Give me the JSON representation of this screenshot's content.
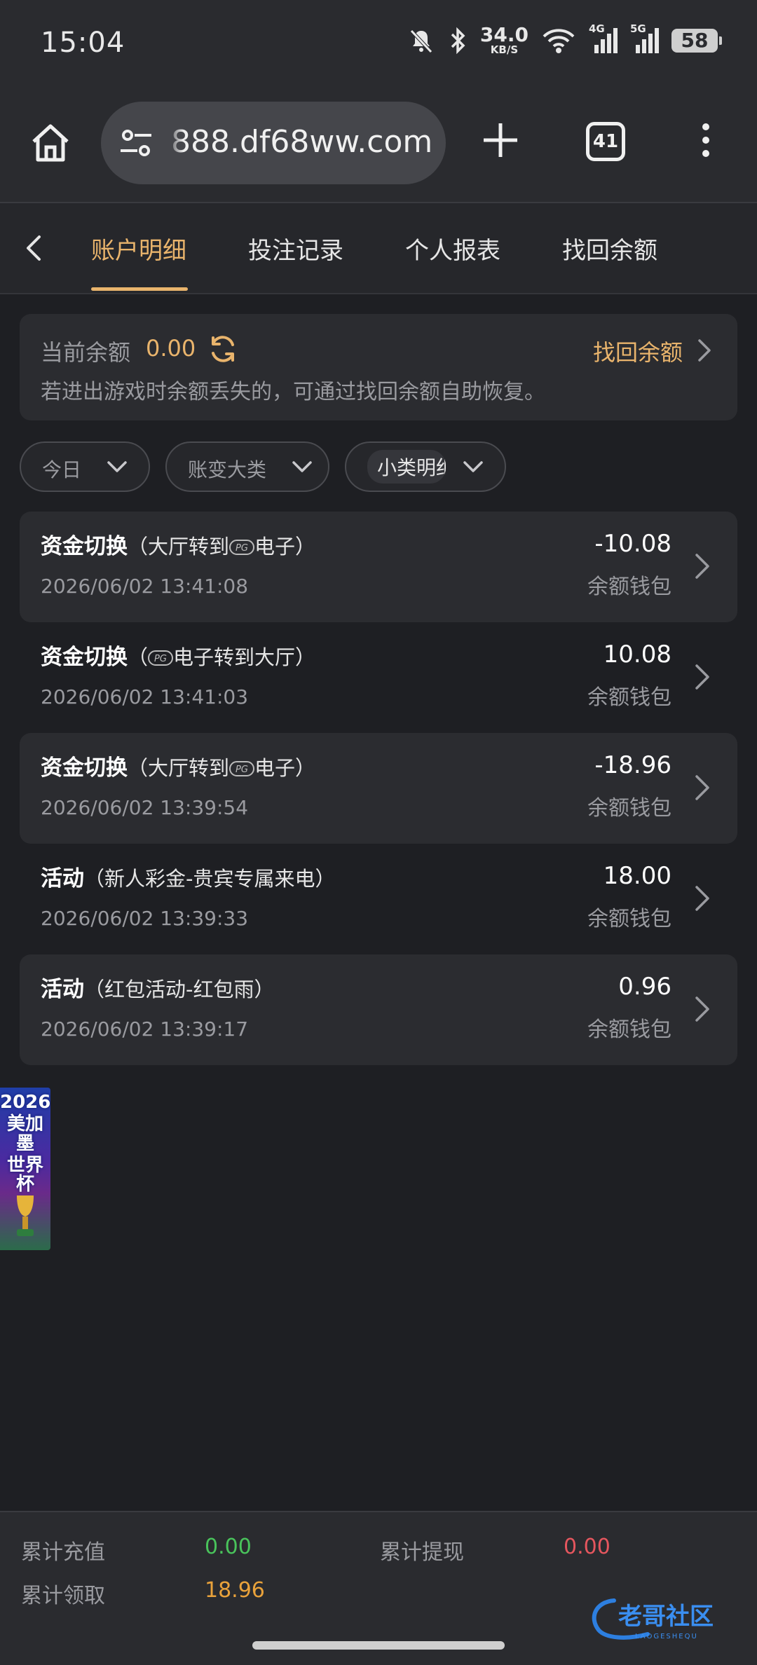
{
  "status_bar": {
    "time": "15:04",
    "net_speed_value": "34.0",
    "net_speed_unit": "KB/S",
    "signal1_label": "4G",
    "signal2_label": "5G",
    "battery": "58"
  },
  "browser": {
    "url": "888.df68ww.com",
    "tab_count": "41"
  },
  "page_tabs": [
    {
      "label": "账户明细",
      "active": true
    },
    {
      "label": "投注记录",
      "active": false
    },
    {
      "label": "个人报表",
      "active": false
    },
    {
      "label": "找回余额",
      "active": false
    }
  ],
  "balance": {
    "label": "当前余额",
    "value": "0.00",
    "recover_link": "找回余额",
    "note": "若进出游戏时余额丢失的，可通过找回余额自助恢复。"
  },
  "filters": [
    {
      "label": "今日"
    },
    {
      "label": "账变大类"
    },
    {
      "label": "小类明细"
    }
  ],
  "transactions": [
    {
      "type": "资金切换",
      "detail_pre": "（大厅转到",
      "detail_post": "电子）",
      "time": "2026/06/02 13:41:08",
      "amount": "-10.08",
      "wallet": "余额钱包"
    },
    {
      "type": "资金切换",
      "detail_pre": "（",
      "detail_post": "电子转到大厅）",
      "time": "2026/06/02 13:41:03",
      "amount": "10.08",
      "wallet": "余额钱包"
    },
    {
      "type": "资金切换",
      "detail_pre": "（大厅转到",
      "detail_post": "电子）",
      "time": "2026/06/02 13:39:54",
      "amount": "-18.96",
      "wallet": "余额钱包"
    },
    {
      "type": "活动",
      "detail_pre": "（新人彩金-贵宾专属来电）",
      "detail_post": "",
      "time": "2026/06/02 13:39:33",
      "amount": "18.00",
      "wallet": "余额钱包"
    },
    {
      "type": "活动",
      "detail_pre": "（红包活动-红包雨）",
      "detail_post": "",
      "time": "2026/06/02 13:39:17",
      "amount": "0.96",
      "wallet": "余额钱包"
    }
  ],
  "promo": {
    "line1": "2026",
    "line2": "美加墨",
    "line3": "世界杯"
  },
  "footer": {
    "recharge_label": "累计充值",
    "recharge_value": "0.00",
    "withdraw_label": "累计提现",
    "withdraw_value": "0.00",
    "claimed_label": "累计领取",
    "claimed_value": "18.96"
  },
  "watermark": {
    "text": "老哥社区",
    "sub": "LAOGESHEQU"
  },
  "colors": {
    "accent": "#e9b46c",
    "green": "#49c35b",
    "red": "#e5565e",
    "orange": "#e9a23b",
    "background": "#1e1f23"
  }
}
